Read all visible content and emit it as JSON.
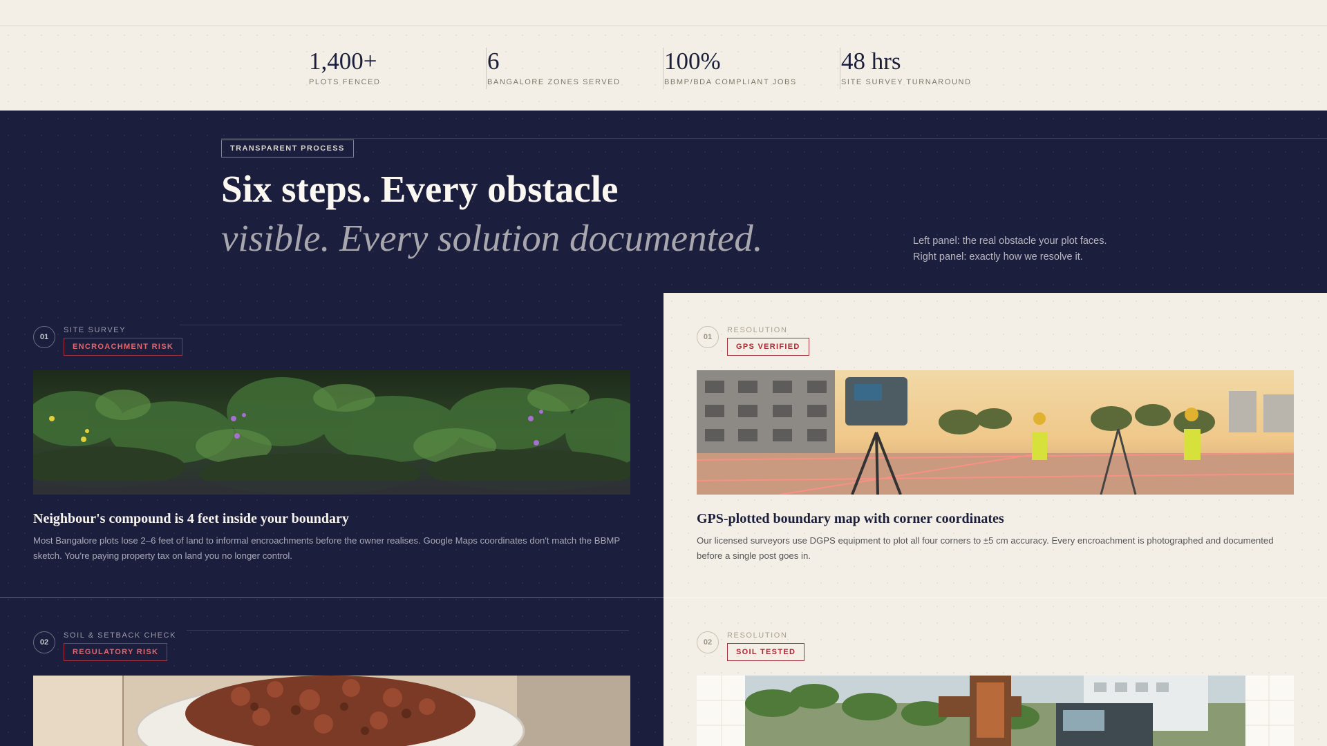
{
  "stats": [
    {
      "value": "1,400+",
      "label": "PLOTS FENCED"
    },
    {
      "value": "6",
      "label": "BANGALORE ZONES SERVED"
    },
    {
      "value": "100%",
      "label": "BBMP/BDA COMPLIANT JOBS"
    },
    {
      "value": "48 hrs",
      "label": "SITE SURVEY TURNAROUND"
    }
  ],
  "hero": {
    "eyebrow": "TRANSPARENT PROCESS",
    "headline_line1": "Six steps. Every obstacle",
    "headline_line2": "visible. Every solution documented.",
    "note_line1": "Left panel: the real obstacle your plot faces.",
    "note_line2": "Right panel: exactly how we resolve it."
  },
  "steps": [
    {
      "number": "01",
      "problem": {
        "kicker": "SITE SURVEY",
        "tag": "ENCROACHMENT RISK",
        "title": "Neighbour's compound is 4 feet inside your boundary",
        "body": "Most Bangalore plots lose 2–6 feet of land to informal encroachments before the owner realises. Google Maps coordinates don't match the BBMP sketch. You're paying property tax on land you no longer control."
      },
      "solution": {
        "kicker": "RESOLUTION",
        "tag": "GPS VERIFIED",
        "title": "GPS-plotted boundary map with corner coordinates",
        "body": "Our licensed surveyors use DGPS equipment to plot all four corners to ±5 cm accuracy. Every encroachment is photographed and documented before a single post goes in."
      }
    },
    {
      "number": "02",
      "problem": {
        "kicker": "SOIL & SETBACK CHECK",
        "tag": "REGULATORY RISK"
      },
      "solution": {
        "kicker": "RESOLUTION",
        "tag": "SOIL TESTED"
      }
    }
  ],
  "colors": {
    "navy": "#1c1e3d",
    "cream": "#f4efe6",
    "accent_red": "#a8262f"
  }
}
